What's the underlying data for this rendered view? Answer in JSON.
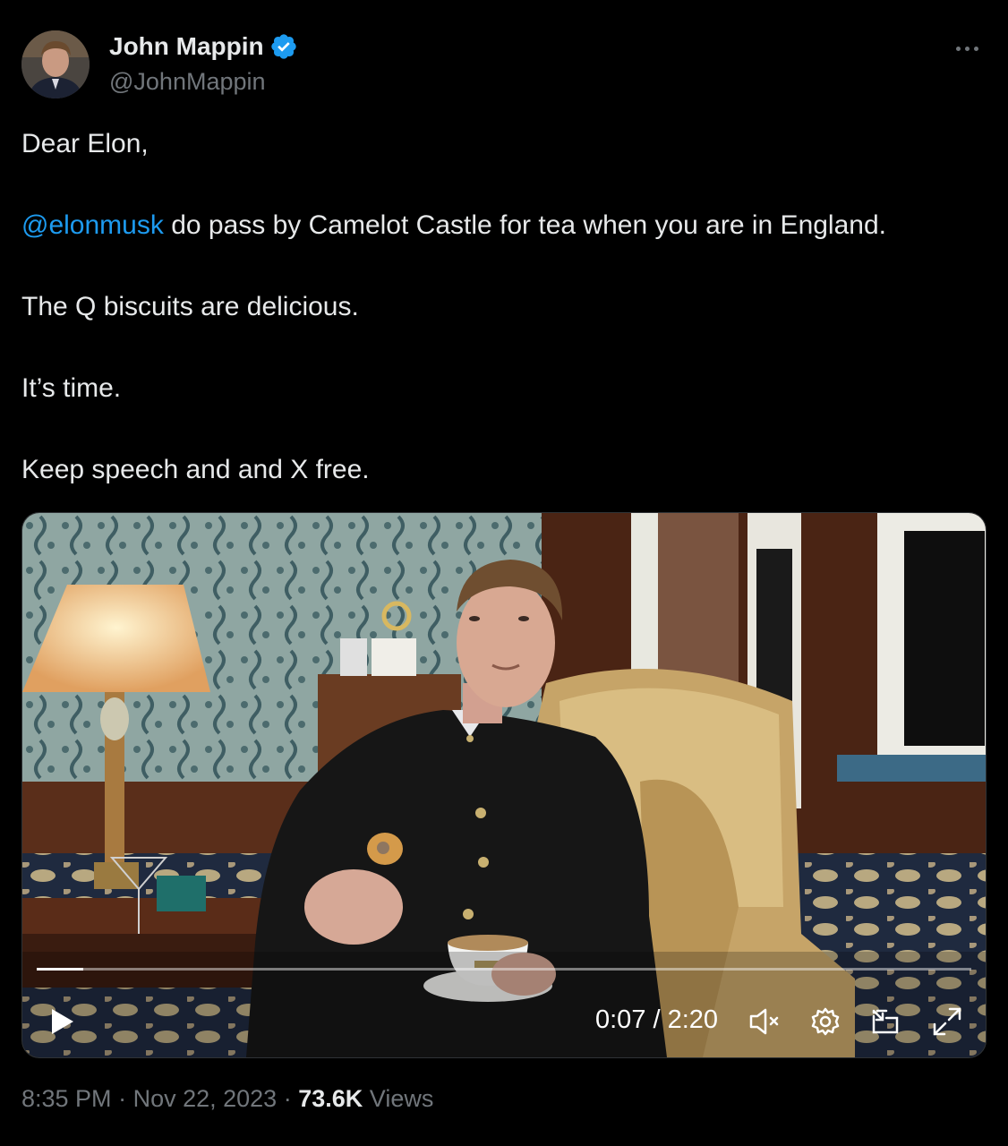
{
  "author": {
    "name": "John Mappin",
    "handle": "@JohnMappin",
    "verified": true
  },
  "tweet": {
    "line1": "Dear Elon,",
    "mention": "@elonmusk",
    "line2_rest": " do pass by Camelot Castle for tea when you are in England.",
    "line3": "The Q biscuits are delicious.",
    "line4": "It’s time.",
    "line5": "Keep speech and and X free."
  },
  "video": {
    "current_time": "0:07",
    "duration": "2:20",
    "time_display": "0:07 / 2:20",
    "progress": 0.05,
    "muted": true,
    "icons": [
      "play-icon",
      "muted-speaker-icon",
      "settings-gear-icon",
      "picture-in-picture-icon",
      "fullscreen-icon"
    ]
  },
  "meta": {
    "time": "8:35 PM",
    "date": "Nov 22, 2023",
    "views_count": "73.6K",
    "views_label": "Views"
  },
  "colors": {
    "background": "#000000",
    "text": "#e7e9ea",
    "secondary": "#71767b",
    "link": "#1d9bf0",
    "verified_badge": "#1d9bf0"
  }
}
